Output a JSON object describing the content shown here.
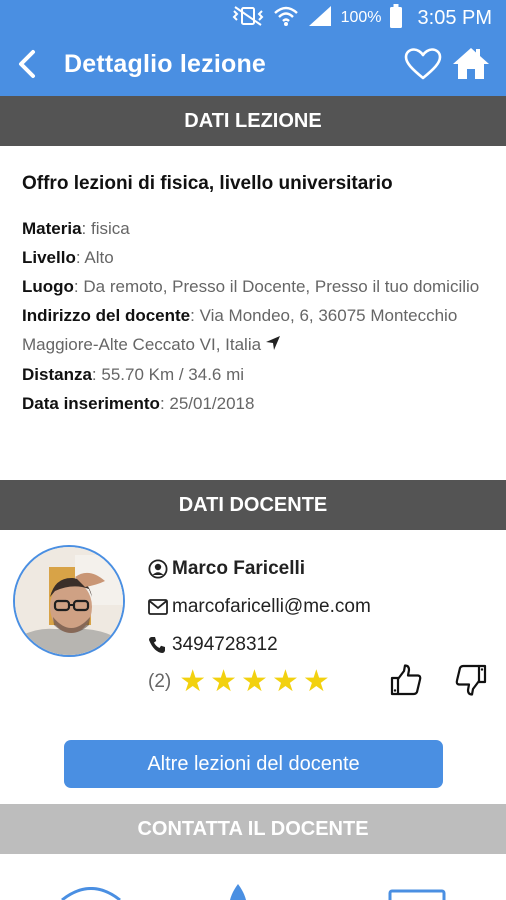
{
  "status_bar": {
    "battery": "100%",
    "time": "3:05 PM"
  },
  "app_bar": {
    "title": "Dettaglio lezione"
  },
  "sections": {
    "lesson_header": "DATI LEZIONE",
    "teacher_header": "DATI DOCENTE",
    "contact_header": "CONTATTA IL DOCENTE"
  },
  "lesson": {
    "title": "Offro lezioni di fisica, livello universitario",
    "fields": [
      {
        "label": "Materia",
        "value": ": fisica"
      },
      {
        "label": "Livello",
        "value": ": Alto"
      },
      {
        "label": "Luogo",
        "value": ": Da remoto, Presso il Docente, Presso il tuo domicilio"
      },
      {
        "label": "Indirizzo del docente",
        "value": ": Via Mondeo, 6, 36075 Montecchio Maggiore-Alte Ceccato VI, Italia"
      },
      {
        "label": "Distanza",
        "value": ": 55.70 Km / 34.6 mi"
      },
      {
        "label": "Data inserimento",
        "value": ": 25/01/2018"
      }
    ]
  },
  "teacher": {
    "name": "Marco Faricelli",
    "email": "marcofaricelli@me.com",
    "phone": "3494728312",
    "rating_count": "(2)",
    "rating_stars": 5
  },
  "buttons": {
    "other_lessons": "Altre lezioni del docente"
  },
  "colors": {
    "primary": "#4a8fe2",
    "header_dark": "#545454",
    "header_light": "#bdbdbd",
    "star": "#f2d10f"
  }
}
